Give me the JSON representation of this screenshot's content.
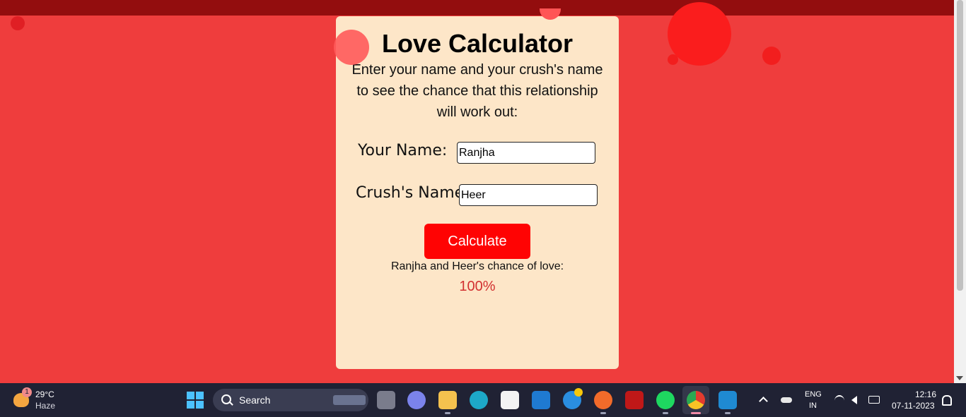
{
  "card": {
    "title": "Love Calculator",
    "description": "Enter your name and your crush's name to see the chance that this relationship will work out:",
    "your_name_label": "Your Name:",
    "your_name_value": "Ranjha",
    "crush_name_label": "Crush's Name:",
    "crush_name_value": "Heer",
    "calculate_label": "Calculate",
    "result_text": "Ranjha and Heer's chance of love:",
    "result_percent": "100%"
  },
  "taskbar": {
    "weather_temp": "29°C",
    "weather_desc": "Haze",
    "weather_badge": "1",
    "search_label": "Search",
    "lang_top": "ENG",
    "lang_bottom": "IN",
    "time": "12:16",
    "date": "07-11-2023"
  },
  "colors": {
    "background": "#ef3d3d",
    "card": "#fde6c8",
    "button": "#ff0303",
    "percent": "#d23030",
    "topbar": "#930d0e"
  }
}
